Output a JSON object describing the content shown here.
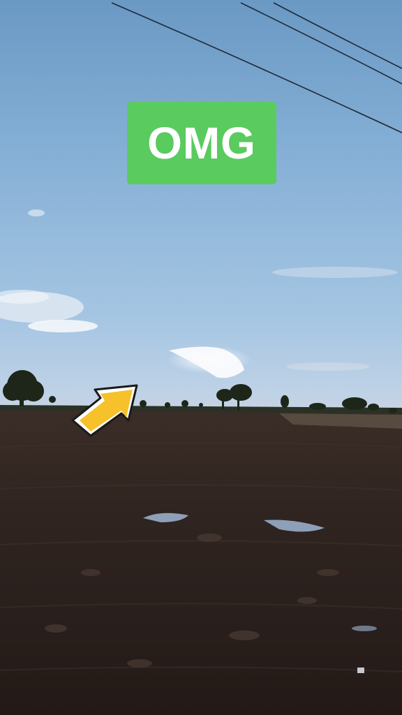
{
  "sticker": {
    "text": "OMG",
    "background_color": "#5acb5e",
    "text_color": "#ffffff"
  },
  "arrow": {
    "icon": "arrow-up-right-icon",
    "fill_color": "#f6c12a",
    "outline_color": "#ffffff"
  },
  "scene": {
    "sky_top_color": "#6a99c4",
    "sky_horizon_color": "#c9d3e1",
    "ground_color": "#2c221e",
    "cloud_color": "#f2f4f6",
    "puddle_color": "#9fb6d3"
  }
}
